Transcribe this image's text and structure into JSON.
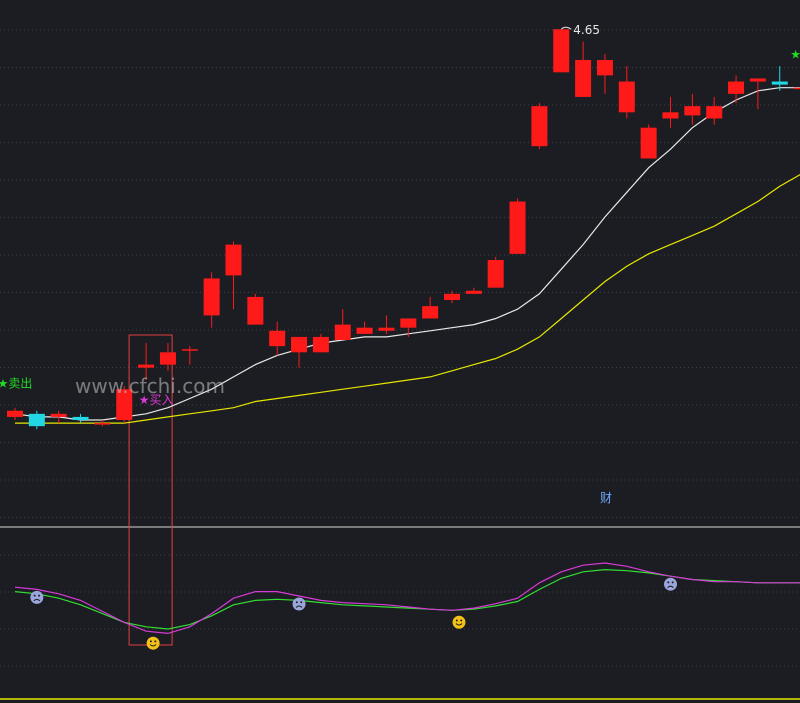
{
  "watermark": "www.cfchi.com",
  "colors": {
    "background": "#1b1d22",
    "up": "#ff1a1a",
    "down": "#22d8e4",
    "ma_fast": "#e8e8e8",
    "ma_slow": "#e6e600",
    "osc_fast": "#d83ad8",
    "osc_slow": "#33dd33",
    "sell_signal": "#22dd22",
    "buy_signal": "#d83ad8",
    "highlight_box": "#e04040",
    "divider": "#d8d8d8",
    "bottom_line": "#e6e600"
  },
  "chart_data": [
    {
      "type": "candlestick",
      "title": "",
      "price_range": [
        3.12,
        4.68
      ],
      "high_annotation": "4.65",
      "candles": [
        {
          "o": 3.39,
          "c": 3.41,
          "h": 3.42,
          "l": 3.38
        },
        {
          "o": 3.4,
          "c": 3.36,
          "h": 3.41,
          "l": 3.35
        },
        {
          "o": 3.39,
          "c": 3.4,
          "h": 3.41,
          "l": 3.37
        },
        {
          "o": 3.39,
          "c": 3.38,
          "h": 3.4,
          "l": 3.37
        },
        {
          "o": 3.37,
          "c": 3.37,
          "h": 3.38,
          "l": 3.36
        },
        {
          "o": 3.38,
          "c": 3.48,
          "h": 3.49,
          "l": 3.37
        },
        {
          "o": 3.55,
          "c": 3.56,
          "h": 3.63,
          "l": 3.51
        },
        {
          "o": 3.56,
          "c": 3.6,
          "h": 3.63,
          "l": 3.54
        },
        {
          "o": 3.61,
          "c": 3.61,
          "h": 3.62,
          "l": 3.56
        },
        {
          "o": 3.72,
          "c": 3.84,
          "h": 3.86,
          "l": 3.68
        },
        {
          "o": 3.85,
          "c": 3.95,
          "h": 3.96,
          "l": 3.74
        },
        {
          "o": 3.69,
          "c": 3.78,
          "h": 3.79,
          "l": 3.69
        },
        {
          "o": 3.62,
          "c": 3.67,
          "h": 3.7,
          "l": 3.59
        },
        {
          "o": 3.6,
          "c": 3.65,
          "h": 3.65,
          "l": 3.55
        },
        {
          "o": 3.6,
          "c": 3.65,
          "h": 3.66,
          "l": 3.6
        },
        {
          "o": 3.64,
          "c": 3.69,
          "h": 3.74,
          "l": 3.64
        },
        {
          "o": 3.66,
          "c": 3.68,
          "h": 3.7,
          "l": 3.66
        },
        {
          "o": 3.67,
          "c": 3.68,
          "h": 3.72,
          "l": 3.66
        },
        {
          "o": 3.68,
          "c": 3.71,
          "h": 3.71,
          "l": 3.65
        },
        {
          "o": 3.71,
          "c": 3.75,
          "h": 3.78,
          "l": 3.71
        },
        {
          "o": 3.77,
          "c": 3.79,
          "h": 3.8,
          "l": 3.76
        },
        {
          "o": 3.79,
          "c": 3.8,
          "h": 3.81,
          "l": 3.79
        },
        {
          "o": 3.81,
          "c": 3.9,
          "h": 3.91,
          "l": 3.81
        },
        {
          "o": 3.92,
          "c": 4.09,
          "h": 4.1,
          "l": 3.92
        },
        {
          "o": 4.27,
          "c": 4.4,
          "h": 4.41,
          "l": 4.26
        },
        {
          "o": 4.51,
          "c": 4.65,
          "h": 4.65,
          "l": 4.51
        },
        {
          "o": 4.43,
          "c": 4.55,
          "h": 4.61,
          "l": 4.43
        },
        {
          "o": 4.5,
          "c": 4.55,
          "h": 4.57,
          "l": 4.44
        },
        {
          "o": 4.38,
          "c": 4.48,
          "h": 4.53,
          "l": 4.36
        },
        {
          "o": 4.23,
          "c": 4.33,
          "h": 4.34,
          "l": 4.23
        },
        {
          "o": 4.36,
          "c": 4.38,
          "h": 4.43,
          "l": 4.33
        },
        {
          "o": 4.37,
          "c": 4.4,
          "h": 4.44,
          "l": 4.34
        },
        {
          "o": 4.36,
          "c": 4.4,
          "h": 4.43,
          "l": 4.34
        },
        {
          "o": 4.44,
          "c": 4.48,
          "h": 4.5,
          "l": 4.41
        },
        {
          "o": 4.48,
          "c": 4.49,
          "h": 4.49,
          "l": 4.39
        },
        {
          "o": 4.48,
          "c": 4.47,
          "h": 4.53,
          "l": 4.45
        },
        {
          "o": 4.46,
          "c": 4.46,
          "h": 4.49,
          "l": 4.44
        }
      ],
      "ma_fast": [
        3.4,
        3.39,
        3.39,
        3.38,
        3.38,
        3.39,
        3.4,
        3.42,
        3.45,
        3.48,
        3.52,
        3.56,
        3.59,
        3.61,
        3.63,
        3.64,
        3.65,
        3.65,
        3.66,
        3.67,
        3.68,
        3.69,
        3.71,
        3.74,
        3.79,
        3.87,
        3.95,
        4.04,
        4.12,
        4.2,
        4.26,
        4.33,
        4.38,
        4.42,
        4.45,
        4.46,
        4.46
      ],
      "ma_slow": [
        3.37,
        3.37,
        3.37,
        3.37,
        3.37,
        3.37,
        3.38,
        3.39,
        3.4,
        3.41,
        3.42,
        3.44,
        3.45,
        3.46,
        3.47,
        3.48,
        3.49,
        3.5,
        3.51,
        3.52,
        3.54,
        3.56,
        3.58,
        3.61,
        3.65,
        3.71,
        3.77,
        3.83,
        3.88,
        3.92,
        3.95,
        3.98,
        4.01,
        4.05,
        4.09,
        4.14,
        4.18
      ],
      "signals": [
        {
          "index": 0,
          "label": "★卖出",
          "kind": "sell"
        },
        {
          "index": 6,
          "label": "★买入",
          "kind": "buy"
        },
        {
          "index": 36,
          "label": "★卖",
          "kind": "sell"
        }
      ],
      "highlight_index": 6,
      "bottom_label": "财"
    },
    {
      "type": "line",
      "title": "",
      "ylim": [
        0,
        100
      ],
      "x_count": 37,
      "series": [
        {
          "key": "fast",
          "values": [
            48,
            46,
            42,
            36,
            26,
            16,
            8,
            6,
            12,
            24,
            38,
            44,
            44,
            40,
            36,
            34,
            33,
            32,
            30,
            28,
            27,
            29,
            33,
            38,
            52,
            62,
            68,
            70,
            67,
            62,
            58,
            55,
            53,
            53,
            52,
            52,
            52
          ]
        },
        {
          "key": "slow",
          "values": [
            44,
            42,
            38,
            32,
            24,
            16,
            12,
            10,
            14,
            22,
            32,
            36,
            37,
            36,
            34,
            32,
            31,
            30,
            29,
            28,
            27,
            28,
            31,
            35,
            46,
            56,
            62,
            64,
            63,
            61,
            58,
            55,
            54,
            53,
            52,
            52,
            52
          ]
        }
      ],
      "markers": [
        {
          "index": 1,
          "kind": "frown"
        },
        {
          "index": 6,
          "kind": "smile"
        },
        {
          "index": 13,
          "kind": "frown"
        },
        {
          "index": 20,
          "kind": "smile"
        },
        {
          "index": 30,
          "kind": "frown"
        }
      ]
    }
  ]
}
